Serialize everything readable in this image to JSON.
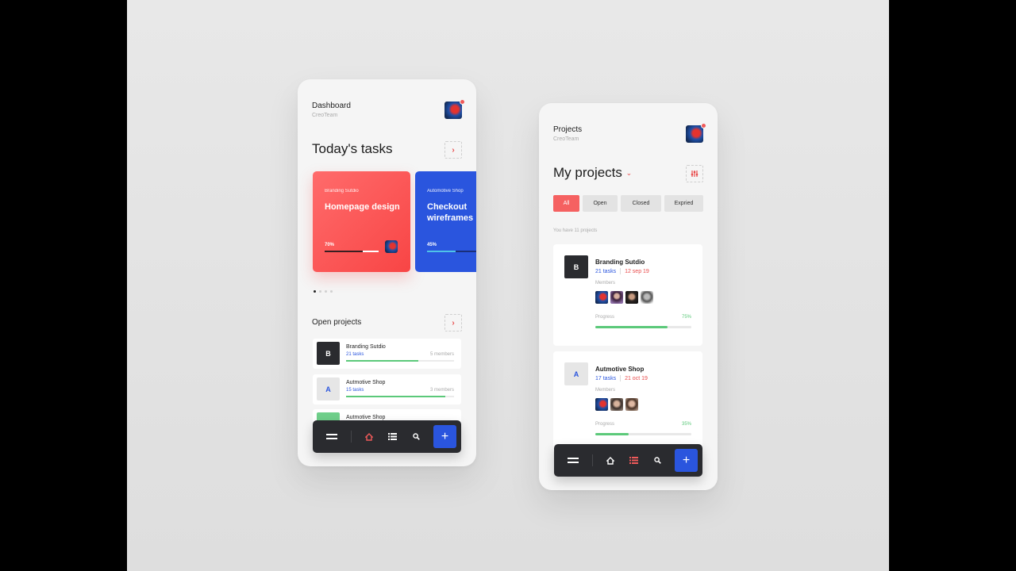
{
  "colors": {
    "accent_red": "#f56161",
    "accent_blue": "#2a55de",
    "accent_green": "#5cc97a",
    "nav_dark": "#2a2b2f"
  },
  "dashboard": {
    "header": {
      "title": "Dashboard",
      "subtitle": "CreoTeam",
      "avatar": "user-avatar",
      "notification": true
    },
    "todays_tasks": {
      "title": "Today's tasks",
      "arrow_icon": "chevron-right-icon",
      "cards": [
        {
          "client": "Branding Sutdio",
          "title": "Homepage design",
          "progress_label": "70%",
          "progress": 0.7,
          "color": "red",
          "assignee": "user-avatar"
        },
        {
          "client": "Automotive Shop",
          "title": "Checkout wireframes",
          "progress_label": "45%",
          "progress": 0.45,
          "color": "blue"
        }
      ],
      "pager": {
        "total": 4,
        "active": 0
      }
    },
    "open_projects": {
      "title": "Open projects",
      "arrow_icon": "chevron-right-icon",
      "items": [
        {
          "letter": "B",
          "name": "Branding Sutdio",
          "tasks": "21 tasks",
          "members": "5 members",
          "progress": 0.67
        },
        {
          "letter": "A",
          "name": "Autmotive Shop",
          "tasks": "15 tasks",
          "members": "3 members",
          "progress": 0.92
        },
        {
          "letter": "",
          "name": "Autmotive Shop",
          "tasks": "",
          "members": "",
          "progress": 0
        }
      ]
    },
    "navbar": {
      "menu": "menu-icon",
      "home": "home-icon",
      "list": "list-icon",
      "search": "search-icon",
      "add_label": "+",
      "active": "home"
    }
  },
  "projects": {
    "header": {
      "title": "Projects",
      "subtitle": "CreoTeam",
      "avatar": "user-avatar",
      "notification": true
    },
    "title": "My projects",
    "dropdown_icon": "chevron-down-icon",
    "filter_icon": "sliders-icon",
    "filters": [
      {
        "label": "All",
        "active": true
      },
      {
        "label": "Open",
        "active": false
      },
      {
        "label": "Closed",
        "active": false
      },
      {
        "label": "Expried",
        "active": false
      }
    ],
    "count_text": "You have 11 projects",
    "cards": [
      {
        "letter": "B",
        "name": "Branding Sutdio",
        "tasks": "21 tasks",
        "date": "12 sep 19",
        "members_label": "Members",
        "member_count": 4,
        "progress_label": "Progress",
        "progress_text": "75%",
        "progress": 0.75
      },
      {
        "letter": "A",
        "name": "Autmotive Shop",
        "tasks": "17 tasks",
        "date": "21 oct 19",
        "members_label": "Members",
        "member_count": 3,
        "progress_label": "Progress",
        "progress_text": "35%",
        "progress": 0.35
      }
    ],
    "navbar": {
      "menu": "menu-icon",
      "home": "home-icon",
      "list": "list-icon",
      "search": "search-icon",
      "add_label": "+",
      "active": "list"
    }
  }
}
